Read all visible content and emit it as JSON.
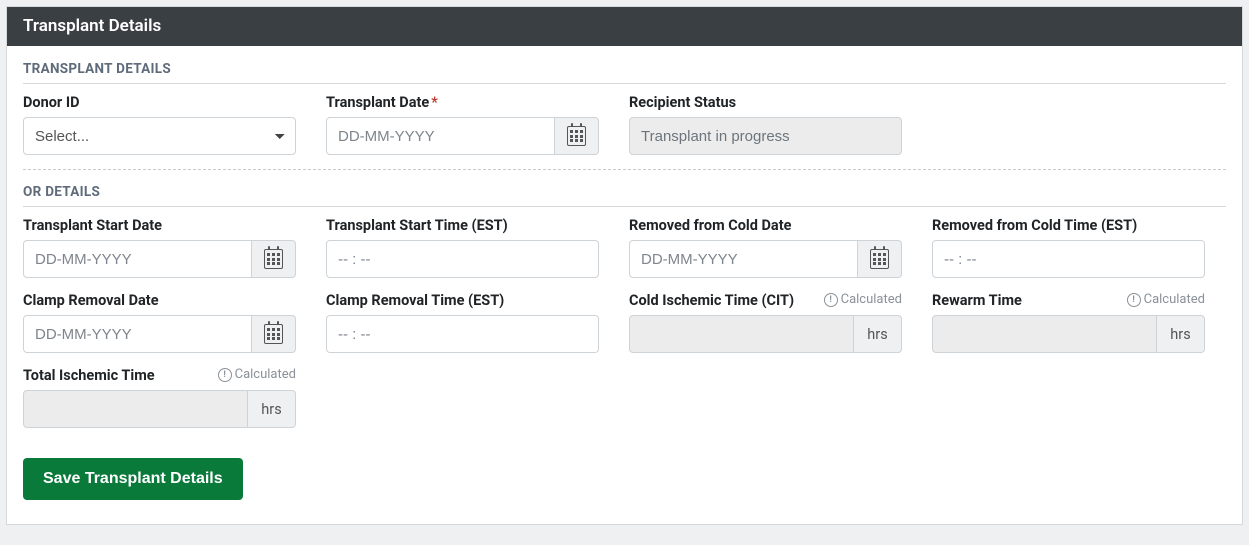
{
  "panel": {
    "title": "Transplant Details"
  },
  "sections": {
    "details": {
      "title": "TRANSPLANT DETAILS"
    },
    "or": {
      "title": "OR DETAILS"
    }
  },
  "placeholders": {
    "date": "DD-MM-YYYY",
    "time": "-- : --"
  },
  "units": {
    "hrs": "hrs"
  },
  "badges": {
    "calculated": "Calculated"
  },
  "fields": {
    "donor_id": {
      "label": "Donor ID",
      "selected": "Select..."
    },
    "transplant_date": {
      "label": "Transplant Date",
      "required": "*"
    },
    "recipient_status": {
      "label": "Recipient Status",
      "value": "Transplant in progress"
    },
    "transplant_start_date": {
      "label": "Transplant Start Date"
    },
    "transplant_start_time": {
      "label": "Transplant Start Time (EST)"
    },
    "removed_cold_date": {
      "label": "Removed from Cold Date"
    },
    "removed_cold_time": {
      "label": "Removed from Cold Time (EST)"
    },
    "clamp_removal_date": {
      "label": "Clamp Removal Date"
    },
    "clamp_removal_time": {
      "label": "Clamp Removal Time (EST)"
    },
    "cit": {
      "label": "Cold Ischemic Time (CIT)"
    },
    "rewarm": {
      "label": "Rewarm Time"
    },
    "total_ischemic": {
      "label": "Total Ischemic Time"
    }
  },
  "buttons": {
    "save": "Save Transplant Details"
  }
}
